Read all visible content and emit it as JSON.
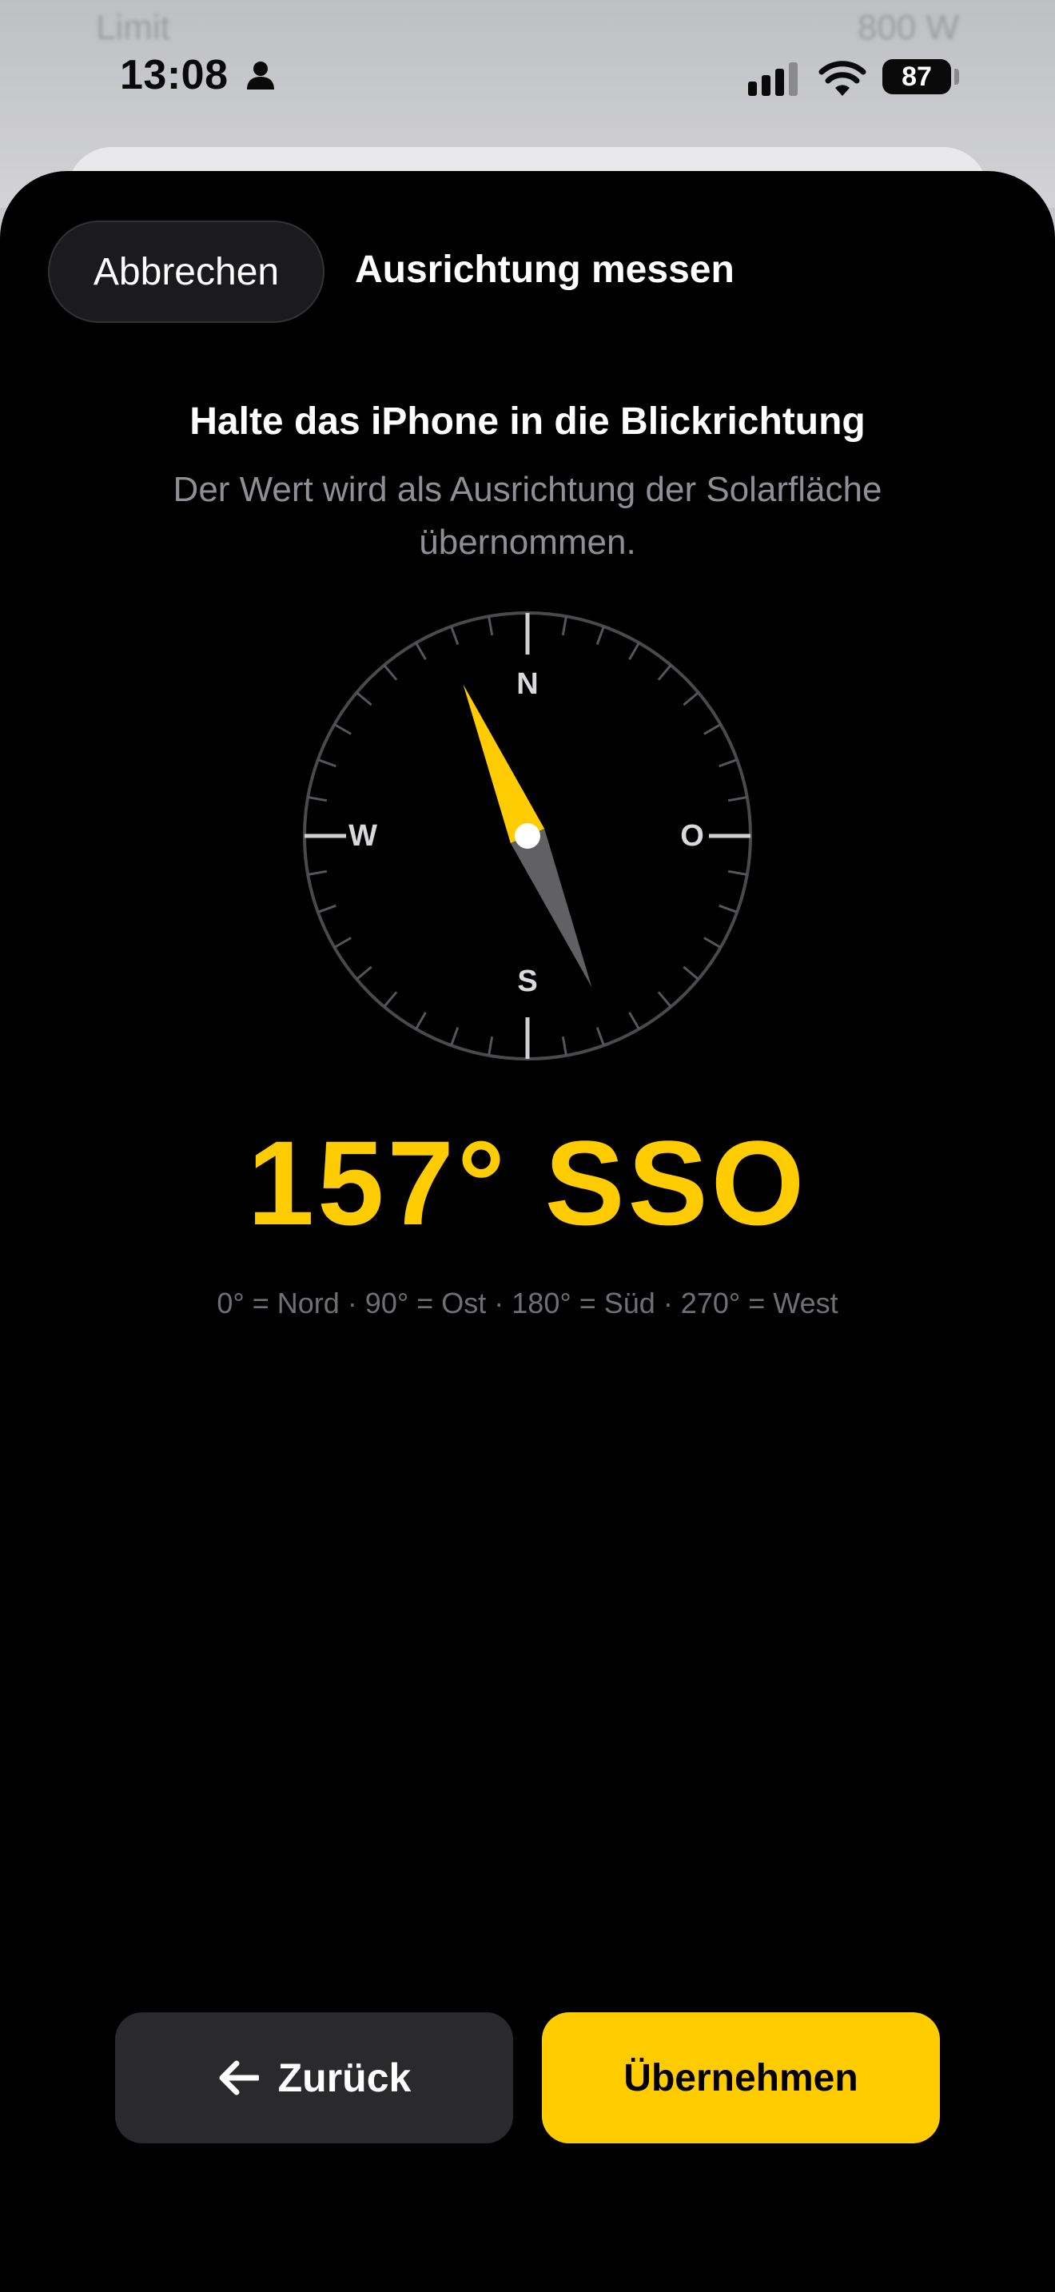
{
  "background": {
    "left_ghost_label": "Limit",
    "right_ghost_value": "800 W"
  },
  "status_bar": {
    "time": "13:08",
    "battery_level": "87"
  },
  "sheet": {
    "cancel_label": "Abbrechen",
    "title": "Ausrichtung messen",
    "instruction": "Halte das iPhone in die Blickrichtung",
    "hint": "Der Wert wird als Ausrichtung der Solarfläche übernommen.",
    "compass": {
      "north_label": "N",
      "east_label": "O",
      "south_label": "S",
      "west_label": "W",
      "heading_degrees": 157
    },
    "heading_text": "157° SSO",
    "legend": "0° = Nord · 90° = Ost · 180° = Süd · 270° = West",
    "back_label": "Zurück",
    "apply_label": "Übernehmen"
  },
  "colors": {
    "accent": "#FFCC00",
    "sheet_background": "#000000",
    "secondary_button": "#2A2A2C"
  }
}
